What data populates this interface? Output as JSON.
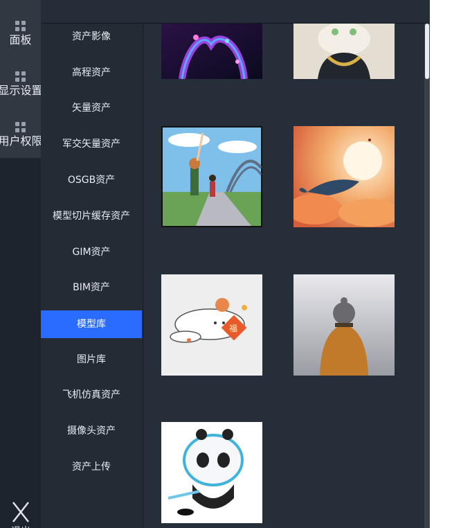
{
  "sidebar": {
    "items": [
      {
        "label": "面板",
        "icon": "grid-icon"
      },
      {
        "label": "显示设置",
        "icon": "grid-icon"
      },
      {
        "label": "用户权限",
        "icon": "grid-icon"
      }
    ],
    "exit_label": "退出"
  },
  "menu": {
    "items": [
      {
        "label": "资产影像"
      },
      {
        "label": "高程资产"
      },
      {
        "label": "矢量资产"
      },
      {
        "label": "军交矢量资产"
      },
      {
        "label": "OSGB资产"
      },
      {
        "label": "模型切片缓存资产"
      },
      {
        "label": "GIM资产"
      },
      {
        "label": "BIM资产"
      },
      {
        "label": "模型库",
        "active": true
      },
      {
        "label": "图片库"
      },
      {
        "label": "飞机仿真资产"
      },
      {
        "label": "摄像头资产"
      },
      {
        "label": "资产上传"
      }
    ]
  },
  "gallery": {
    "items": [
      {
        "subject": "neon heart hands"
      },
      {
        "subject": "cat with gold chain"
      },
      {
        "subject": "anime kids on road"
      },
      {
        "subject": "whale in orange clouds"
      },
      {
        "subject": "cinnamoroll bunny"
      },
      {
        "subject": "person in knit hat"
      },
      {
        "subject": "bing dwen dwen hockey"
      }
    ]
  },
  "colors": {
    "accent": "#2a6cff",
    "background": "#252d38",
    "rail": "#1d242d"
  }
}
